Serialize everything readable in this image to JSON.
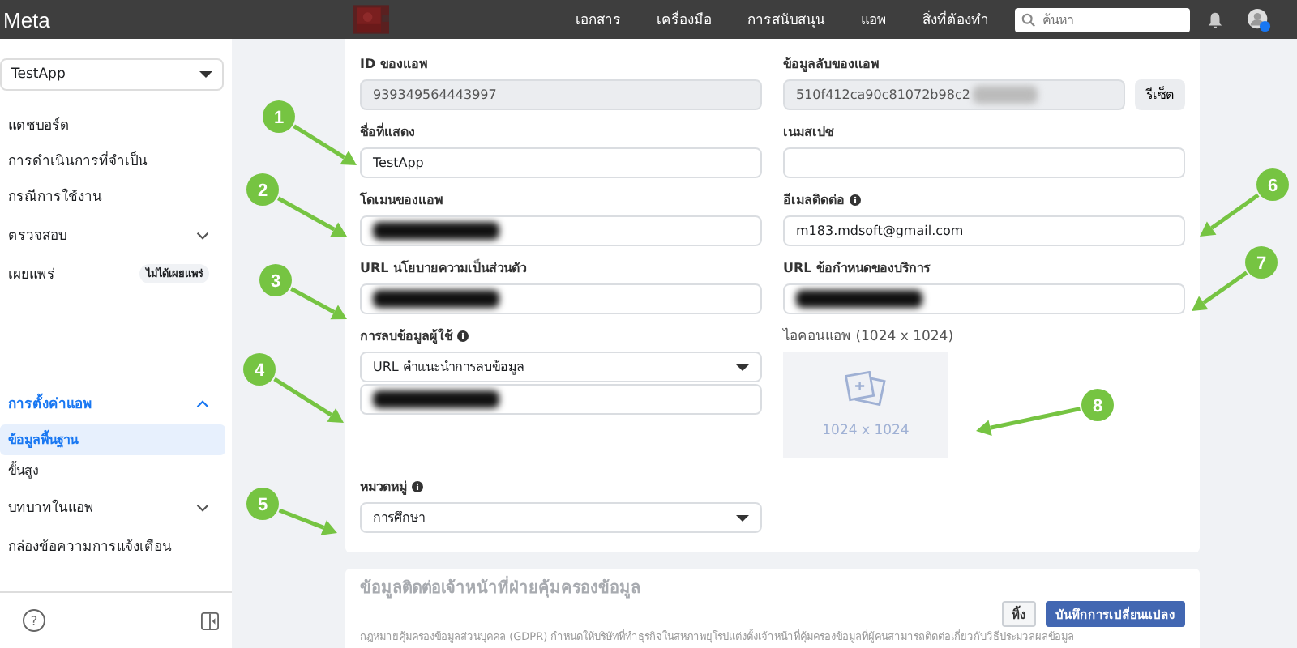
{
  "topbar": {
    "logo": "Meta",
    "nav": [
      {
        "label": "เอกสาร"
      },
      {
        "label": "เครื่องมือ"
      },
      {
        "label": "การสนับสนุน"
      },
      {
        "label": "แอพ"
      },
      {
        "label": "สิ่งที่ต้องทำ"
      }
    ],
    "search": {
      "placeholder": "ค้นหา"
    }
  },
  "sidebar": {
    "app_selector": "TestApp",
    "help": "?",
    "items": [
      {
        "label": "แดชบอร์ด",
        "kind": "link",
        "selected": false
      },
      {
        "label": "การดำเนินการที่จำเป็น",
        "kind": "link",
        "selected": false
      },
      {
        "label": "กรณีการใช้งาน",
        "kind": "link",
        "selected": false
      },
      {
        "label": "ตรวจสอบ",
        "kind": "group",
        "selected": false,
        "expanded": false
      },
      {
        "label": "เผยแพร่",
        "kind": "link",
        "selected": false,
        "badge": "ไม่ได้เผยแพร่"
      },
      {
        "label": "การตั้งค่าแอพ",
        "kind": "group",
        "selected": true,
        "expanded": true,
        "children": [
          {
            "label": "ข้อมูลพื้นฐาน",
            "kind": "sub",
            "selected": true
          },
          {
            "label": "ขั้นสูง",
            "kind": "sub",
            "selected": false
          }
        ]
      },
      {
        "label": "บทบาทในแอพ",
        "kind": "group",
        "selected": false,
        "expanded": false
      },
      {
        "label": "กล่องข้อความการแจ้งเตือน",
        "kind": "link",
        "selected": false
      }
    ]
  },
  "form": {
    "rows": [
      [
        {
          "label": "ID ของแอพ",
          "value": "939349564443997",
          "disabled": true
        },
        {
          "label": "ข้อมูลลับของแอพ",
          "value": "510f412ca90c81072b98c2",
          "disabled": true,
          "redacted": true,
          "button": "รีเซ็ต"
        }
      ],
      [
        {
          "label": "ชื่อที่แสดง",
          "value": "TestApp",
          "disabled": false
        },
        {
          "label": "เนมสเปซ",
          "disabled": false
        }
      ],
      [
        {
          "label": "โดเมนของแอพ",
          "disabled": false,
          "redacted": true
        },
        {
          "label": "อีเมลติดต่อ",
          "info": true,
          "value": "m183.mdsoft@gmail.com",
          "disabled": false
        }
      ],
      [
        {
          "label": "URL นโยบายความเป็นส่วนตัว",
          "disabled": false,
          "redacted": true
        },
        {
          "label": "URL ข้อกำหนดของบริการ",
          "disabled": false,
          "redacted": true
        }
      ]
    ],
    "data_deletion": {
      "label": "การลบข้อมูลผู้ใช้",
      "info": true,
      "select": "URL คำแนะนำการลบข้อมูล",
      "redacted": true
    },
    "category": {
      "label": "หมวดหมู่",
      "info": true,
      "select": "การศึกษา"
    },
    "app_icon": {
      "label": "ไอคอนแอพ (1024 x 1024)",
      "hint": "1024 x 1024"
    }
  },
  "dpo_section": {
    "title": "ข้อมูลติดต่อเจ้าหน้าที่ฝ่ายคุ้มครองข้อมูล",
    "text": "กฎหมายคุ้มครองข้อมูลส่วนบุคคล (GDPR) กำหนดให้บริษัทที่ทำธุรกิจในสหภาพยุโรปแต่งตั้งเจ้าหน้าที่คุ้มครองข้อมูลที่ผู้คนสามารถติดต่อเกี่ยวกับวิธีประมวลผลข้อมูล"
  },
  "footer": {
    "buttons": [
      {
        "label": "ทิ้ง",
        "kind": "secondary"
      },
      {
        "label": "บันทึกการเปลี่ยนแปลง",
        "kind": "primary"
      }
    ]
  },
  "callouts": [
    "1",
    "2",
    "3",
    "4",
    "5",
    "6",
    "7",
    "8"
  ]
}
